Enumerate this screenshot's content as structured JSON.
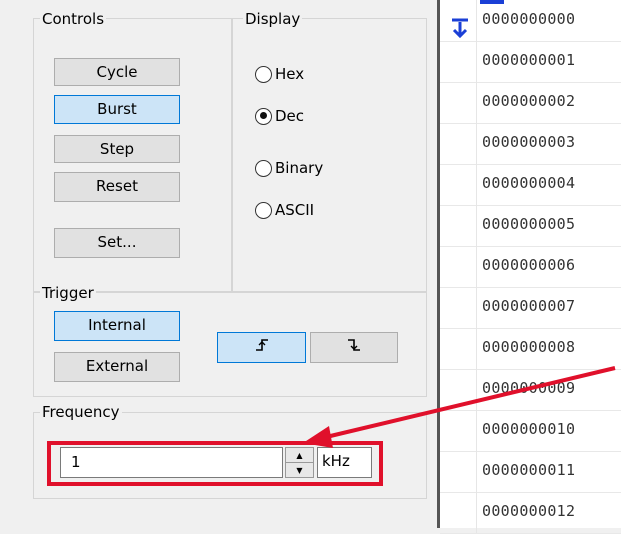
{
  "controls": {
    "label": "Controls",
    "buttons": [
      "Cycle",
      "Burst",
      "Step",
      "Reset"
    ],
    "set_label": "Set..."
  },
  "display": {
    "label": "Display",
    "options": [
      "Hex",
      "Dec",
      "Binary",
      "ASCII"
    ],
    "selected": "Dec"
  },
  "trigger": {
    "label": "Trigger",
    "internal": "Internal",
    "external": "External",
    "rising_glyph": "⨍",
    "falling_glyph": "ᒣ"
  },
  "frequency": {
    "label": "Frequency",
    "value": "1",
    "unit": "kHz"
  },
  "list": {
    "marker_icon": "bookmark-down-arrow-icon",
    "rows": [
      "0000000000",
      "0000000001",
      "0000000002",
      "0000000003",
      "0000000004",
      "0000000005",
      "0000000006",
      "0000000007",
      "0000000008",
      "0000000009",
      "0000000010",
      "0000000011",
      "0000000012"
    ]
  },
  "annotation": {
    "color": "#e0102b"
  }
}
